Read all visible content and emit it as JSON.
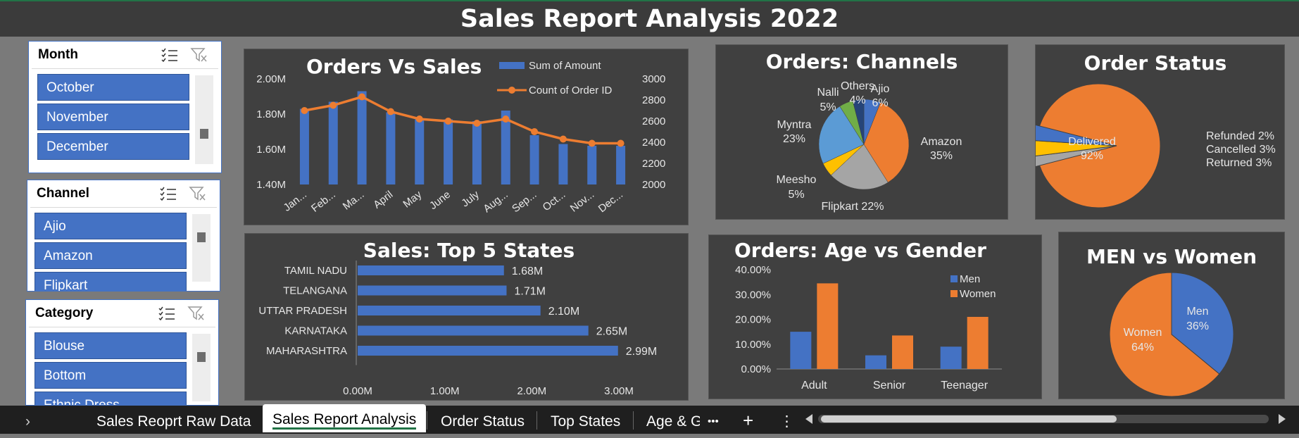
{
  "dashboard_title": "Sales Report Analysis 2022",
  "slicers": {
    "month": {
      "title": "Month",
      "items": [
        "October",
        "November",
        "December"
      ]
    },
    "channel": {
      "title": "Channel",
      "items": [
        "Ajio",
        "Amazon",
        "Flipkart"
      ]
    },
    "category": {
      "title": "Category",
      "items": [
        "Blouse",
        "Bottom",
        "Ethnic Dress"
      ]
    }
  },
  "charts": {
    "orders_vs_sales": {
      "title": "Orders Vs Sales",
      "legend_bar": "Sum of Amount",
      "legend_line": "Count of Order ID"
    },
    "orders_channels": {
      "title": "Orders: Channels"
    },
    "order_status": {
      "title": "Order Status"
    },
    "top_states": {
      "title": "Sales: Top 5 States"
    },
    "age_gender": {
      "title": "Orders: Age vs Gender",
      "legend_men": "Men",
      "legend_women": "Women"
    },
    "men_women": {
      "title": "MEN vs Women"
    }
  },
  "chart_data": [
    {
      "type": "bar",
      "title": "Orders Vs Sales",
      "categories": [
        "Jan...",
        "Feb...",
        "Ma...",
        "April",
        "May",
        "June",
        "July",
        "Aug...",
        "Sep...",
        "Oct...",
        "Nov...",
        "Dec..."
      ],
      "series": [
        {
          "name": "Sum of Amount",
          "type": "bar",
          "axis": "left",
          "values": [
            1.83,
            1.87,
            1.93,
            1.81,
            1.77,
            1.77,
            1.76,
            1.82,
            1.68,
            1.63,
            1.62,
            1.62
          ]
        },
        {
          "name": "Count of Order ID",
          "type": "line",
          "axis": "right",
          "values": [
            2700,
            2750,
            2830,
            2690,
            2620,
            2600,
            2580,
            2620,
            2500,
            2430,
            2390,
            2390
          ]
        }
      ],
      "ylim": [
        1.4,
        2.0
      ],
      "yticks": [
        "1.40M",
        "1.60M",
        "1.80M",
        "2.00M"
      ],
      "y2lim": [
        2000,
        3000
      ],
      "y2ticks": [
        "2000",
        "2200",
        "2400",
        "2600",
        "2800",
        "3000"
      ],
      "colors": {
        "bar": "#4472c4",
        "line": "#ed7d31"
      },
      "legend": "top-right"
    },
    {
      "type": "pie",
      "title": "Orders: Channels",
      "labels": [
        "Ajio",
        "Amazon",
        "Flipkart",
        "Meesho",
        "Myntra",
        "Nalli",
        "Others"
      ],
      "values": [
        6,
        35,
        22,
        5,
        23,
        5,
        4
      ],
      "value_labels": [
        "6%",
        "35%",
        "22%",
        "5%",
        "23%",
        "5%",
        "4%"
      ],
      "colors": [
        "#4472c4",
        "#ed7d31",
        "#a5a5a5",
        "#ffc000",
        "#5b9bd5",
        "#70ad47",
        "#264478"
      ]
    },
    {
      "type": "pie",
      "title": "Order Status",
      "labels": [
        "Delivered",
        "Refunded",
        "Cancelled",
        "Returned"
      ],
      "values": [
        92,
        2,
        3,
        3
      ],
      "value_labels": [
        "92%",
        "2%",
        "3%",
        "3%"
      ],
      "colors": [
        "#ed7d31",
        "#a5a5a5",
        "#ffc000",
        "#4472c4"
      ]
    },
    {
      "type": "bar",
      "orientation": "horizontal",
      "title": "Sales: Top 5 States",
      "categories": [
        "TAMIL NADU",
        "TELANGANA",
        "UTTAR PRADESH",
        "KARNATAKA",
        "MAHARASHTRA"
      ],
      "values": [
        1.68,
        1.71,
        2.1,
        2.65,
        2.99
      ],
      "value_labels": [
        "1.68M",
        "1.71M",
        "2.10M",
        "2.65M",
        "2.99M"
      ],
      "xlim": [
        0,
        3
      ],
      "xticks": [
        "0.00M",
        "1.00M",
        "2.00M",
        "3.00M"
      ],
      "color": "#4472c4"
    },
    {
      "type": "bar",
      "title": "Orders: Age vs Gender",
      "categories": [
        "Adult",
        "Senior",
        "Teenager"
      ],
      "series": [
        {
          "name": "Men",
          "values": [
            15.0,
            5.5,
            9.0
          ],
          "color": "#4472c4"
        },
        {
          "name": "Women",
          "values": [
            34.5,
            13.5,
            21.0
          ],
          "color": "#ed7d31"
        }
      ],
      "ylim": [
        0,
        40
      ],
      "yticks": [
        "0.00%",
        "10.00%",
        "20.00%",
        "30.00%",
        "40.00%"
      ],
      "legend": "top-right"
    },
    {
      "type": "pie",
      "title": "MEN vs Women",
      "labels": [
        "Men",
        "Women"
      ],
      "values": [
        36,
        64
      ],
      "value_labels": [
        "36%",
        "64%"
      ],
      "colors": [
        "#4472c4",
        "#ed7d31"
      ]
    }
  ],
  "tabs": [
    "Sales Reoprt Raw Data",
    "Sales Report Analysis",
    "Order Status",
    "Top States",
    "Age & G"
  ],
  "active_tab": "Sales Report Analysis",
  "tab_controls": {
    "more": "•••",
    "add": "+",
    "menu": "⋮",
    "nav": "›"
  }
}
